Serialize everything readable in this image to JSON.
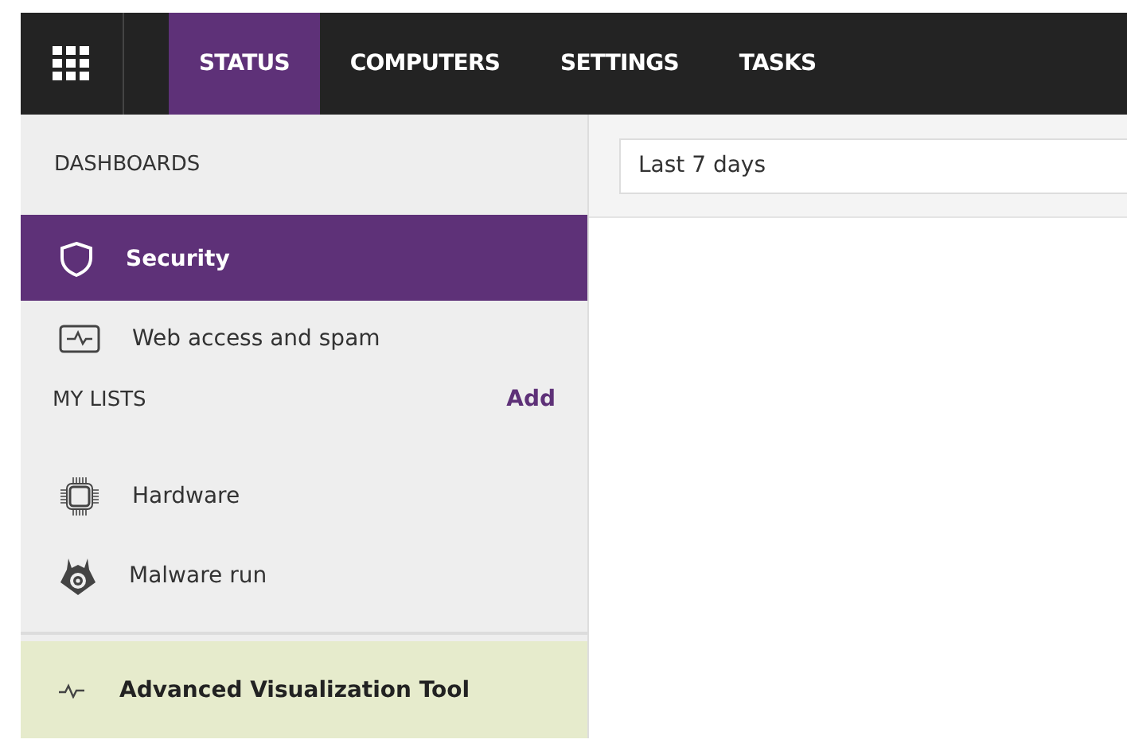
{
  "nav": {
    "tabs": [
      {
        "label": "STATUS",
        "selected": true
      },
      {
        "label": "COMPUTERS",
        "selected": false
      },
      {
        "label": "SETTINGS",
        "selected": false
      },
      {
        "label": "TASKS",
        "selected": false
      }
    ]
  },
  "sidebar": {
    "dashboards_title": "DASHBOARDS",
    "dashboards": [
      {
        "label": "Security",
        "selected": true
      },
      {
        "label": "Web access and spam",
        "selected": false
      }
    ],
    "my_lists_title": "MY LISTS",
    "add_link": "Add",
    "lists": [
      {
        "label": "Hardware",
        "selected": false
      },
      {
        "label": "Malware run",
        "selected": false
      }
    ],
    "tool": {
      "label": "Advanced Visualization Tool"
    }
  },
  "filter": {
    "value": "Last 7 days"
  }
}
